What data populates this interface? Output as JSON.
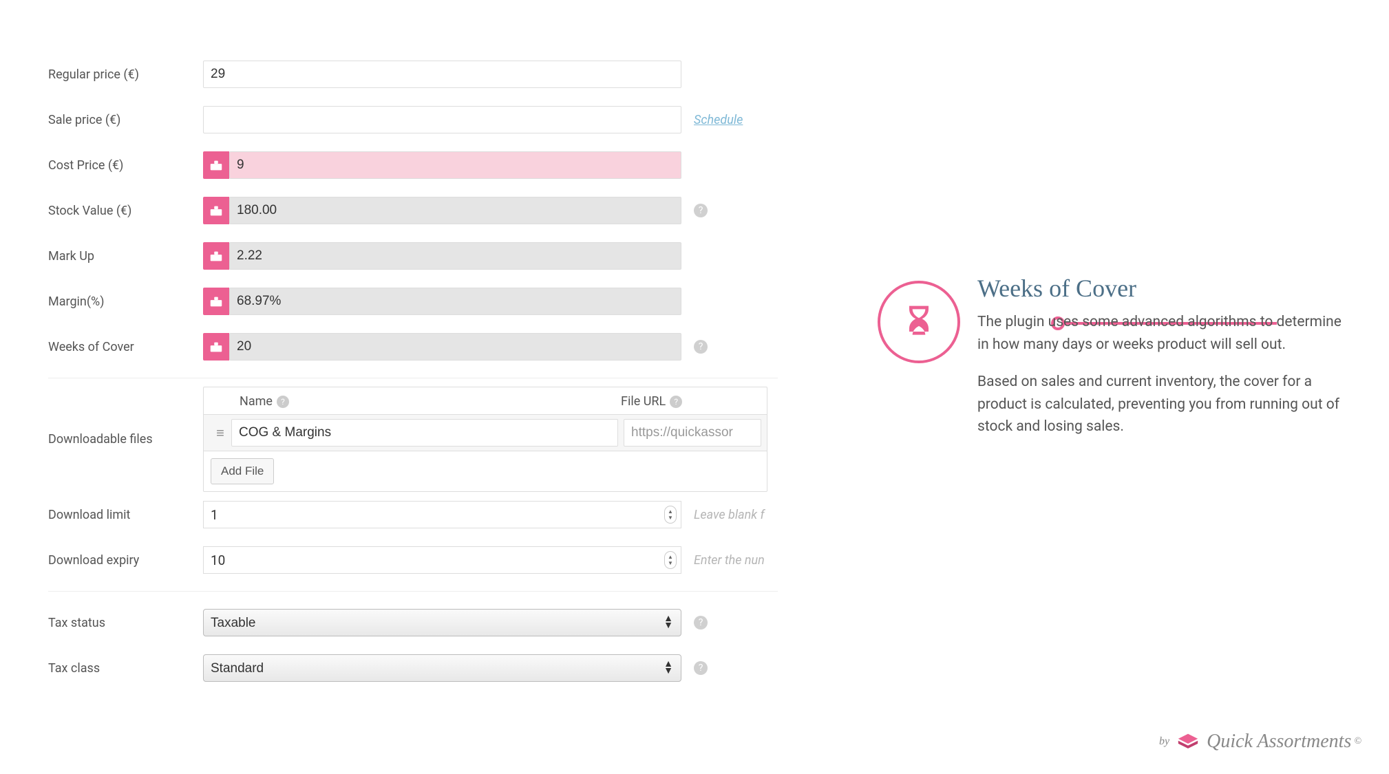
{
  "fields": {
    "regular_price": {
      "label": "Regular price (€)",
      "value": "29"
    },
    "sale_price": {
      "label": "Sale price (€)",
      "value": "",
      "schedule_link": "Schedule"
    },
    "cost_price": {
      "label": "Cost Price (€)",
      "value": "9"
    },
    "stock_value": {
      "label": "Stock Value (€)",
      "value": "180.00"
    },
    "mark_up": {
      "label": "Mark Up",
      "value": "2.22"
    },
    "margin": {
      "label": "Margin(%)",
      "value": "68.97%"
    },
    "weeks_cover": {
      "label": "Weeks of Cover",
      "value": "20"
    }
  },
  "downloadable": {
    "label": "Downloadable files",
    "columns": {
      "name": "Name",
      "url": "File URL"
    },
    "rows": [
      {
        "name": "COG & Margins",
        "url": "https://quickassor"
      }
    ],
    "add_btn": "Add File"
  },
  "download_limit": {
    "label": "Download limit",
    "value": "1",
    "hint": "Leave blank f"
  },
  "download_expiry": {
    "label": "Download expiry",
    "value": "10",
    "hint": "Enter the nun"
  },
  "tax_status": {
    "label": "Tax status",
    "value": "Taxable"
  },
  "tax_class": {
    "label": "Tax class",
    "value": "Standard"
  },
  "callout": {
    "title": "Weeks of Cover",
    "p1": "The plugin uses some advanced algorithms to determine in how many days or weeks product will sell out.",
    "p2": "Based on sales and current inventory, the cover for a product is calculated, preventing you from running out of stock and losing sales."
  },
  "brand": {
    "by": "by",
    "name": "Quick Assortments",
    "copyright": "©"
  }
}
